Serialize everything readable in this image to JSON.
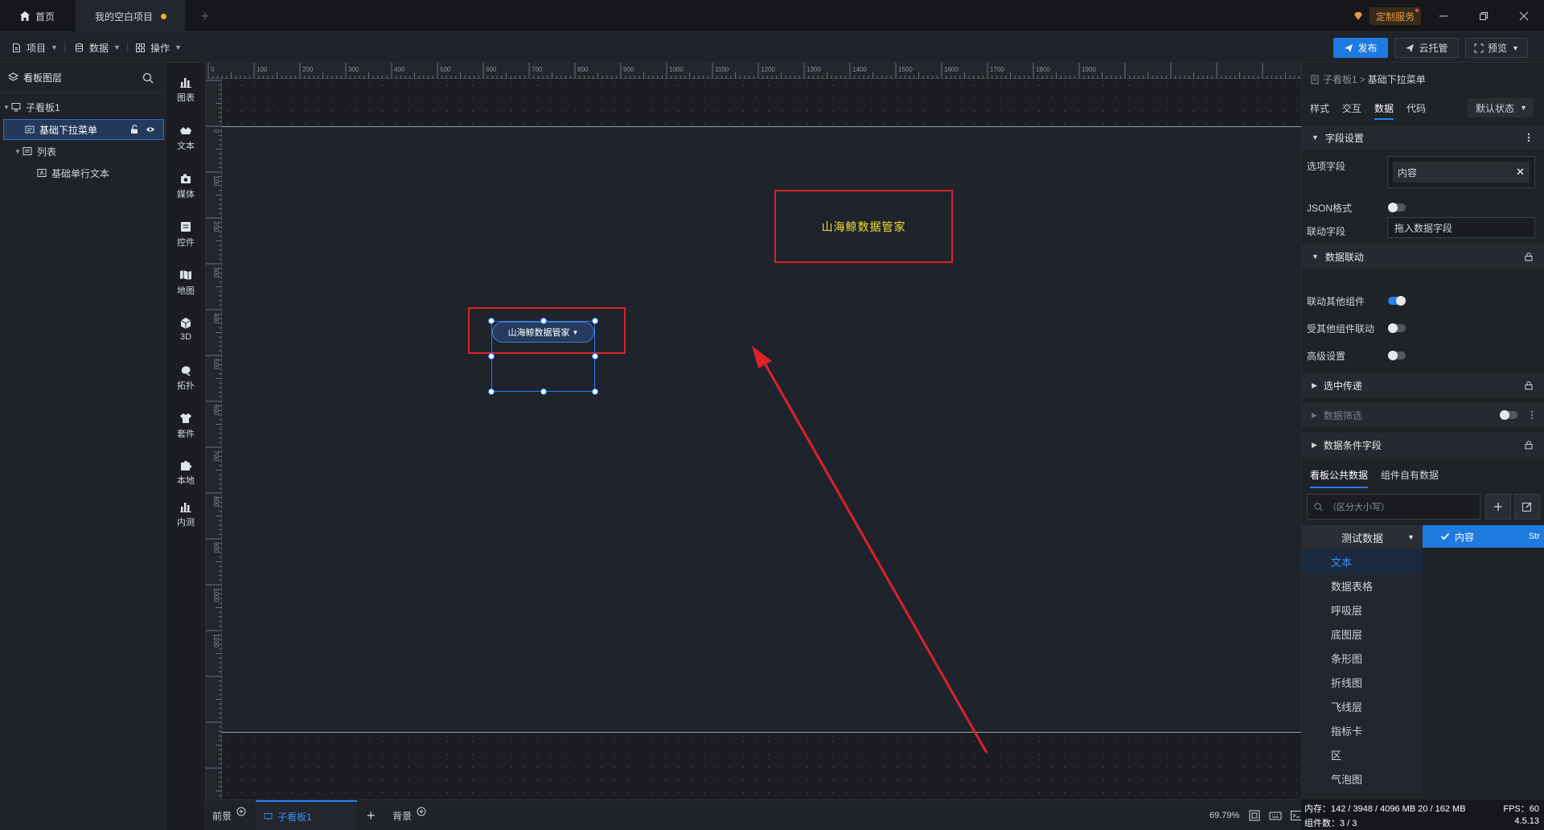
{
  "titlebar": {
    "home_tab": "首页",
    "project_tab": "我的空白项目",
    "custom_service": "定制服务"
  },
  "menubar": {
    "project": "项目",
    "data": "数据",
    "operation": "操作",
    "publish": "发布",
    "cloud_hosting": "云托管",
    "preview": "预览"
  },
  "layers": {
    "title": "看板图层",
    "items": [
      {
        "label": "子看板1"
      },
      {
        "label": "基础下拉菜单"
      },
      {
        "label": "列表"
      },
      {
        "label": "基础单行文本"
      }
    ]
  },
  "components": [
    {
      "label": "图表",
      "icon": "chart-icon"
    },
    {
      "label": "文本",
      "icon": "text-icon"
    },
    {
      "label": "媒体",
      "icon": "media-icon"
    },
    {
      "label": "控件",
      "icon": "control-icon"
    },
    {
      "label": "地图",
      "icon": "map-icon"
    },
    {
      "label": "3D",
      "icon": "cube-icon"
    },
    {
      "label": "拓扑",
      "icon": "topology-icon"
    },
    {
      "label": "套件",
      "icon": "suit-icon"
    },
    {
      "label": "本地",
      "icon": "puzzle-icon"
    },
    {
      "label": "内测",
      "icon": "beta-chart-icon"
    }
  ],
  "ruler": {
    "top_ticks": [
      "0",
      "100",
      "200",
      "300",
      "400",
      "500",
      "600",
      "700",
      "800",
      "900",
      "1000",
      "1100",
      "1200",
      "1300",
      "1400",
      "1500",
      "1600",
      "1700",
      "1800",
      "1900"
    ],
    "left_ticks": [
      "0",
      "100",
      "200",
      "300",
      "400",
      "500",
      "600",
      "700",
      "800",
      "900",
      "1000",
      "1100"
    ]
  },
  "canvas": {
    "title_text": "山海鲸数据管家",
    "dropdown_text": "山海鲸数据管家"
  },
  "bottombar": {
    "foreground": "前景",
    "board_tab": "子看板1",
    "background": "背景",
    "zoom": "69.79%"
  },
  "props": {
    "crumb_parent": "子看板1",
    "crumb_sep": ">",
    "crumb_current": "基础下拉菜单",
    "tabs": [
      "样式",
      "交互",
      "数据",
      "代码"
    ],
    "state": "默认状态",
    "field_settings": "字段设置",
    "option_field_label": "选项字段",
    "option_field_value": "内容",
    "json_format": "JSON格式",
    "link_field_label": "联动字段",
    "link_field_placeholder": "拖入数据字段",
    "data_linkage": "数据联动",
    "link_other": "联动其他组件",
    "linked_by_other": "受其他组件联动",
    "advanced": "高级设置",
    "select_pass": "选中传递",
    "data_filter": "数据筛选",
    "data_condition": "数据条件字段",
    "data_tabs": [
      "看板公共数据",
      "组件自有数据"
    ],
    "search_placeholder": "（区分大小写）",
    "data_group": "测试数据",
    "data_items": [
      "文本",
      "数据表格",
      "呼吸层",
      "底图层",
      "条形图",
      "折线图",
      "飞线层",
      "指标卡",
      "区",
      "气泡图"
    ],
    "selected_field": "内容",
    "selected_field_type": "Str"
  },
  "status": {
    "memory": "内存：142 / 3948 / 4096 MB  20 / 162 MB",
    "fps": "FPS：60",
    "components": "组件数：3 / 3",
    "version": "4.5.13"
  },
  "colors": {
    "accent": "#1f7ae0",
    "annotation_red": "#e0202a",
    "title_yellow": "#f2e12c"
  }
}
